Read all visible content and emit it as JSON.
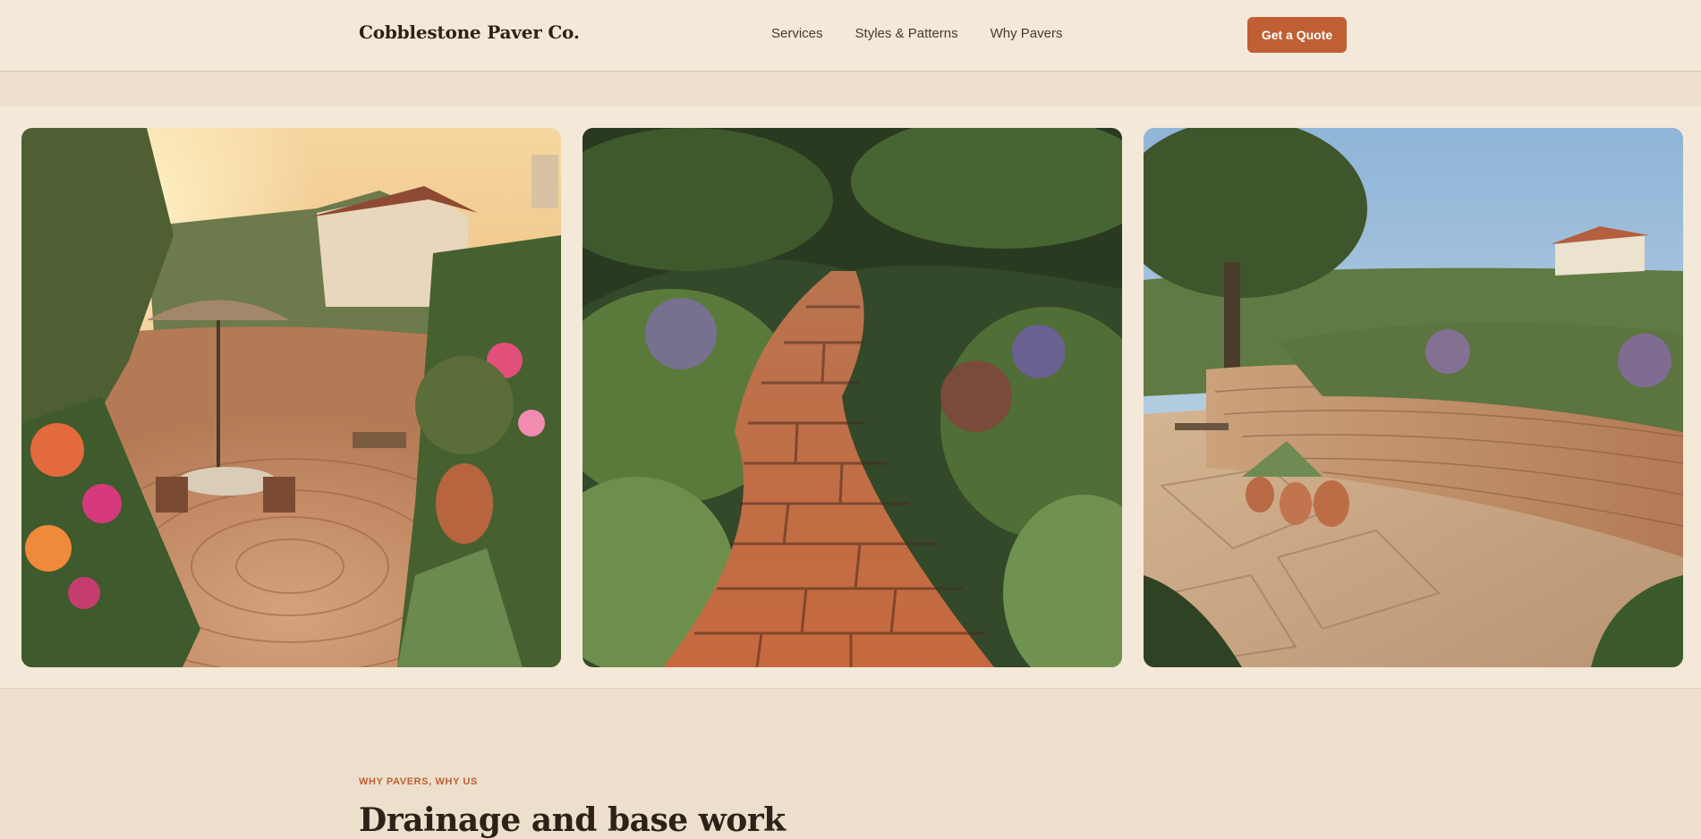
{
  "header": {
    "brand": "Cobblestone Paver Co.",
    "nav": [
      "Services",
      "Styles & Patterns",
      "Why Pavers"
    ],
    "cta": "Get a Quote"
  },
  "gallery": [
    {
      "subject": "circular paver patio with dining set, umbrella and flowering garden at sunset"
    },
    {
      "subject": "winding brick garden path through lush plantings"
    },
    {
      "subject": "flagstone patio with stacked stone retaining wall and potted succulents"
    }
  ],
  "section": {
    "eyebrow": "WHY PAVERS, WHY US",
    "title": "Drainage and base work"
  },
  "colors": {
    "accent": "#bf5f33",
    "header_bg": "#f4e8d8",
    "page_bg": "#ece0cc",
    "text": "#2e2118"
  }
}
